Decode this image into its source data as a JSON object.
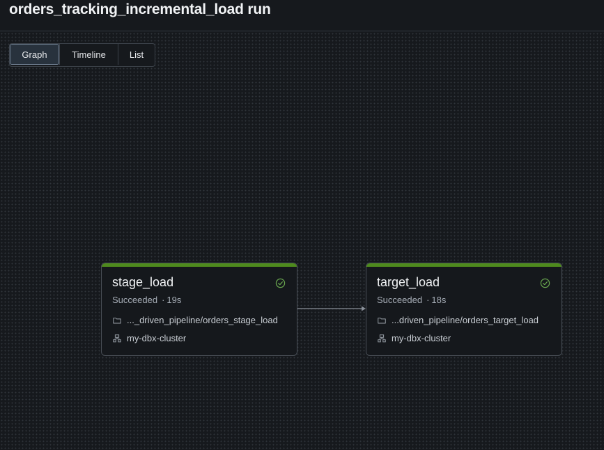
{
  "page": {
    "title": "orders_tracking_incremental_load run"
  },
  "view_tabs": [
    {
      "label": "Graph",
      "active": true
    },
    {
      "label": "Timeline",
      "active": false
    },
    {
      "label": "List",
      "active": false
    }
  ],
  "tasks": [
    {
      "name": "stage_load",
      "status": "Succeeded",
      "duration": "19s",
      "notebook_path": "..._driven_pipeline/orders_stage_load",
      "cluster": "my-dbx-cluster",
      "status_color": "#4e8a1d"
    },
    {
      "name": "target_load",
      "status": "Succeeded",
      "duration": "18s",
      "notebook_path": "...driven_pipeline/orders_target_load",
      "cluster": "my-dbx-cluster",
      "status_color": "#4e8a1d"
    }
  ],
  "icons": {
    "status": "check-circle-icon",
    "path": "folder-icon",
    "cluster": "cluster-icon"
  },
  "colors": {
    "success": "#4e8a1d",
    "check": "#6aa84f",
    "background": "#16191d"
  }
}
